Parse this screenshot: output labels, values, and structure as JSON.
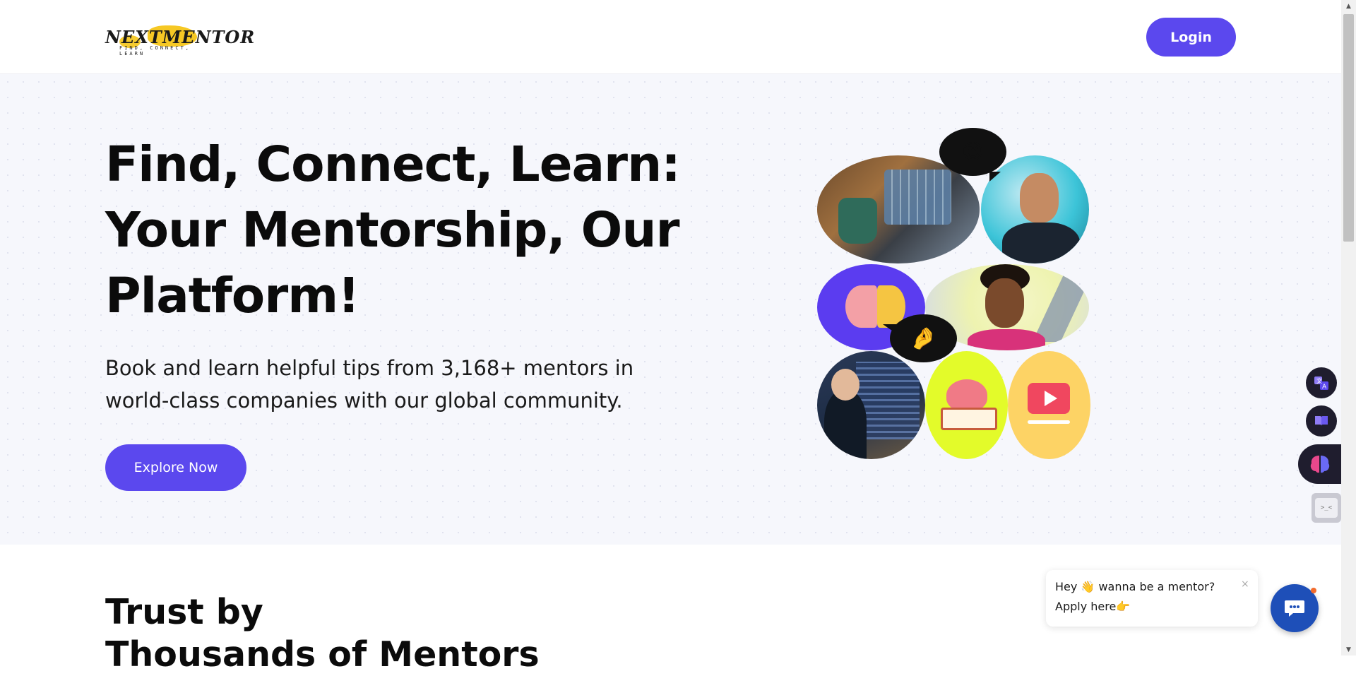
{
  "header": {
    "logo_text": "NEXTMENTOR",
    "logo_tagline": "FIND, CONNECT, LEARN",
    "login_label": "Login"
  },
  "hero": {
    "title_line1": "Find, Connect, Learn:",
    "title_line2": "Your Mentorship, Our",
    "title_line3": "Platform!",
    "subtitle_line1": "Book and learn helpful tips from 3,168+ mentors in",
    "subtitle_line2": "world-class companies with our global community.",
    "explore_label": "Explore Now",
    "emoji_love": "😍",
    "emoji_hand": "🤌"
  },
  "trust": {
    "title_line1": "Trust by",
    "title_line2": "Thousands of Mentors"
  },
  "chat": {
    "line1": "Hey 👋 wanna be a mentor?",
    "line2": "Apply here👉",
    "close": "×"
  },
  "tools": {
    "term_text": ">_<"
  },
  "colors": {
    "brand": "#5b48ee",
    "hero_bg": "#f6f7fc",
    "chat_fab": "#1e4fb8"
  },
  "icons": [
    "logo-icon",
    "translate-icon",
    "book-icon",
    "brain-icon",
    "terminal-icon",
    "chat-icon",
    "close-icon"
  ]
}
